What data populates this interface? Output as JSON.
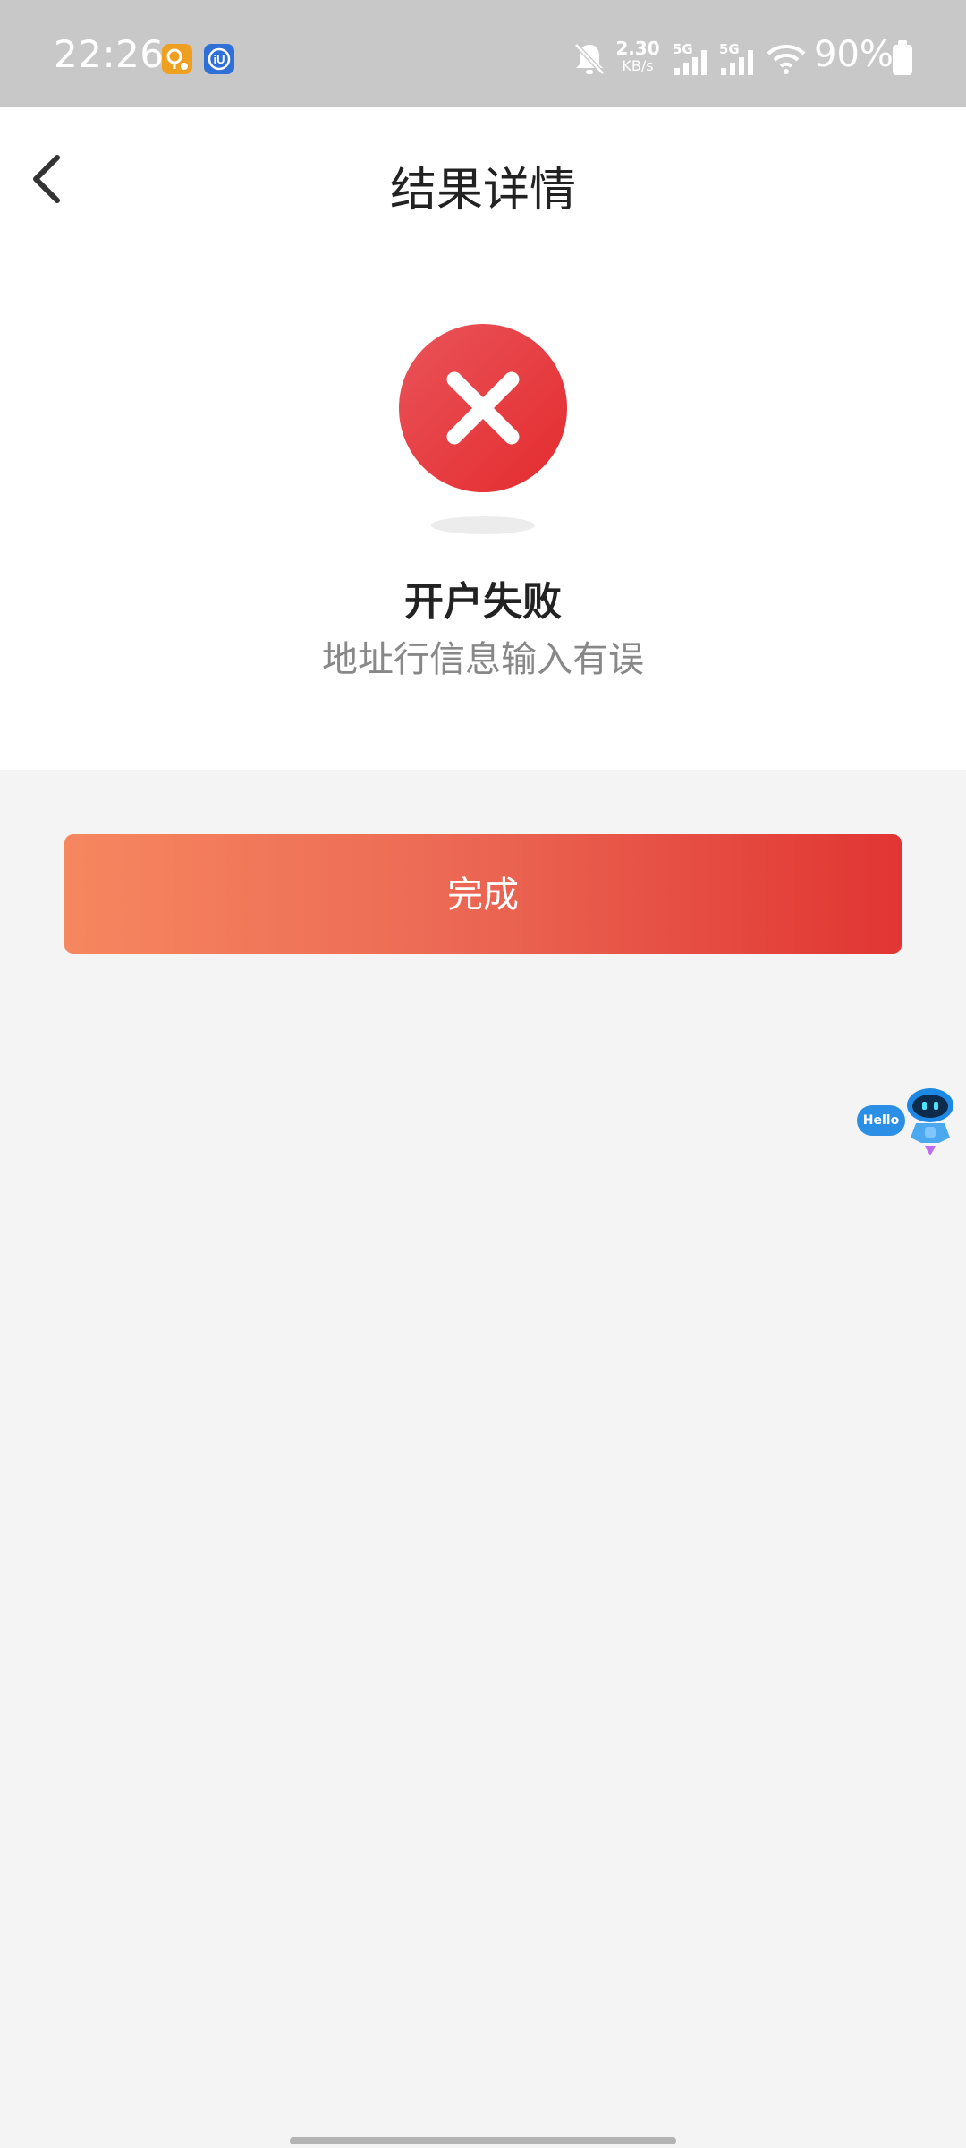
{
  "status_bar": {
    "time": "22:26",
    "network_speed_value": "2.30",
    "network_speed_unit": "KB/s",
    "signal1_label": "5G",
    "signal2_label": "5G",
    "battery_percent": "90%",
    "icons": [
      "notification-app-icon",
      "iu-app-icon",
      "bell-muted-icon",
      "signal-icon",
      "signal-icon",
      "wifi-icon",
      "battery-icon"
    ]
  },
  "header": {
    "title": "结果详情",
    "back_icon": "chevron-left-icon"
  },
  "result": {
    "status": "failure",
    "icon": "error-x-circle-icon",
    "title": "开户失败",
    "message": "地址行信息输入有误",
    "icon_color": "#e8383a"
  },
  "actions": {
    "done_label": "完成",
    "gradient_start": "#f6875f",
    "gradient_end": "#e13533"
  },
  "assistant": {
    "bubble_text": "Hello",
    "icon": "robot-assistant-icon"
  }
}
